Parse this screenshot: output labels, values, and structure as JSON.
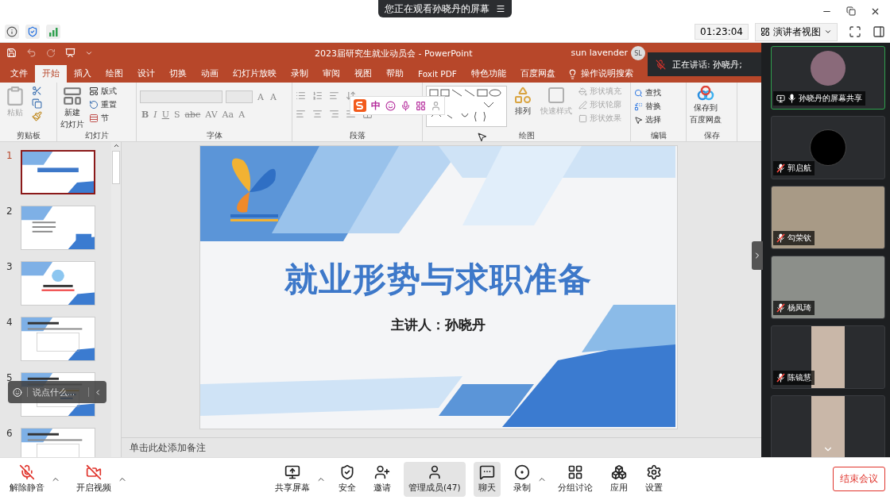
{
  "meeting_bar": {
    "banner": "您正在观看孙晓丹的屏幕",
    "timer": "01:23:04",
    "view_menu": "演讲者视图"
  },
  "ppt": {
    "title": "2023届研究生就业动员会  -  PowerPoint",
    "user": "sun lavender",
    "user_initials": "SL",
    "tabs": [
      {
        "label": "文件",
        "selected": false
      },
      {
        "label": "开始",
        "selected": true
      },
      {
        "label": "插入",
        "selected": false
      },
      {
        "label": "绘图",
        "selected": false
      },
      {
        "label": "设计",
        "selected": false
      },
      {
        "label": "切换",
        "selected": false
      },
      {
        "label": "动画",
        "selected": false
      },
      {
        "label": "幻灯片放映",
        "selected": false
      },
      {
        "label": "录制",
        "selected": false
      },
      {
        "label": "审阅",
        "selected": false
      },
      {
        "label": "视图",
        "selected": false
      },
      {
        "label": "帮助",
        "selected": false
      },
      {
        "label": "Foxit PDF",
        "selected": false
      },
      {
        "label": "特色功能",
        "selected": false
      },
      {
        "label": "百度网盘",
        "selected": false
      }
    ],
    "tell_me": "操作说明搜索",
    "ribbon": {
      "clipboard": {
        "title": "剪贴板",
        "paste": {
          "label": "粘贴",
          "disabled": true
        }
      },
      "slides": {
        "title": "幻灯片",
        "new_slide": [
          "新建",
          "幻灯片"
        ],
        "layout": "版式",
        "reset": "重置",
        "section": "节"
      },
      "font": {
        "title": "字体",
        "size_buttons": [
          "A",
          "A"
        ],
        "format_buttons": [
          "B",
          "I",
          "U",
          "S",
          "abc",
          "AV",
          "Aa",
          "A"
        ]
      },
      "paragraph": {
        "title": "段落"
      },
      "drawing": {
        "title": "绘图",
        "arrange": "排列",
        "quick_styles": {
          "label": "快速样式",
          "disabled": true
        },
        "shape_fill": {
          "label": "形状填充",
          "disabled": true
        },
        "shape_outline": {
          "label": "形状轮廓",
          "disabled": true
        },
        "shape_effects": {
          "label": "形状效果",
          "disabled": true
        }
      },
      "editing": {
        "title": "编辑",
        "find": "查找",
        "replace": "替换",
        "select": "选择"
      },
      "save": {
        "title": "保存",
        "save_baidu": [
          "保存到",
          "百度网盘"
        ]
      }
    },
    "ime": {
      "mode": "中"
    },
    "thumbnails": [
      {
        "number": "1",
        "selected": true
      },
      {
        "number": "2",
        "selected": false
      },
      {
        "number": "3",
        "selected": false
      },
      {
        "number": "4",
        "selected": false
      },
      {
        "number": "5",
        "selected": false
      },
      {
        "number": "6",
        "selected": false
      }
    ],
    "slide": {
      "title": "就业形势与求职准备",
      "presenter": "主讲人：孙晓丹"
    },
    "notes_placeholder": "单击此处添加备注"
  },
  "speaking": "正在讲话: 孙晓丹;",
  "chat_input": {
    "placeholder": "说点什么..."
  },
  "participants": [
    {
      "name": "孙晓丹的屏幕共享",
      "kind": "screen_share",
      "muted": false,
      "active": true
    },
    {
      "name": "郭启航",
      "kind": "avatar",
      "muted": true,
      "active": false
    },
    {
      "name": "勾荣钦",
      "kind": "video",
      "muted": true,
      "active": false
    },
    {
      "name": "杨凤琦",
      "kind": "video",
      "muted": true,
      "active": false
    },
    {
      "name": "陈镜慧",
      "kind": "portrait",
      "muted": true,
      "active": false
    },
    {
      "kind": "portrait",
      "active": false
    }
  ],
  "toolbar": [
    {
      "label": "解除静音",
      "menu": true,
      "selected": false
    },
    {
      "label": "开启视频",
      "menu": true,
      "selected": false
    },
    {
      "label": "共享屏幕",
      "menu": true,
      "selected": false
    },
    {
      "label": "安全",
      "menu": false,
      "selected": false
    },
    {
      "label": "邀请",
      "menu": false,
      "selected": false
    },
    {
      "label": "管理成员(47)",
      "menu": false,
      "selected": true
    },
    {
      "label": "聊天",
      "menu": false,
      "selected": true
    },
    {
      "label": "录制",
      "menu": true,
      "selected": false
    },
    {
      "label": "分组讨论",
      "menu": false,
      "selected": false
    },
    {
      "label": "应用",
      "menu": false,
      "selected": false
    },
    {
      "label": "设置",
      "menu": false,
      "selected": false
    }
  ],
  "end_button": "结束会议"
}
